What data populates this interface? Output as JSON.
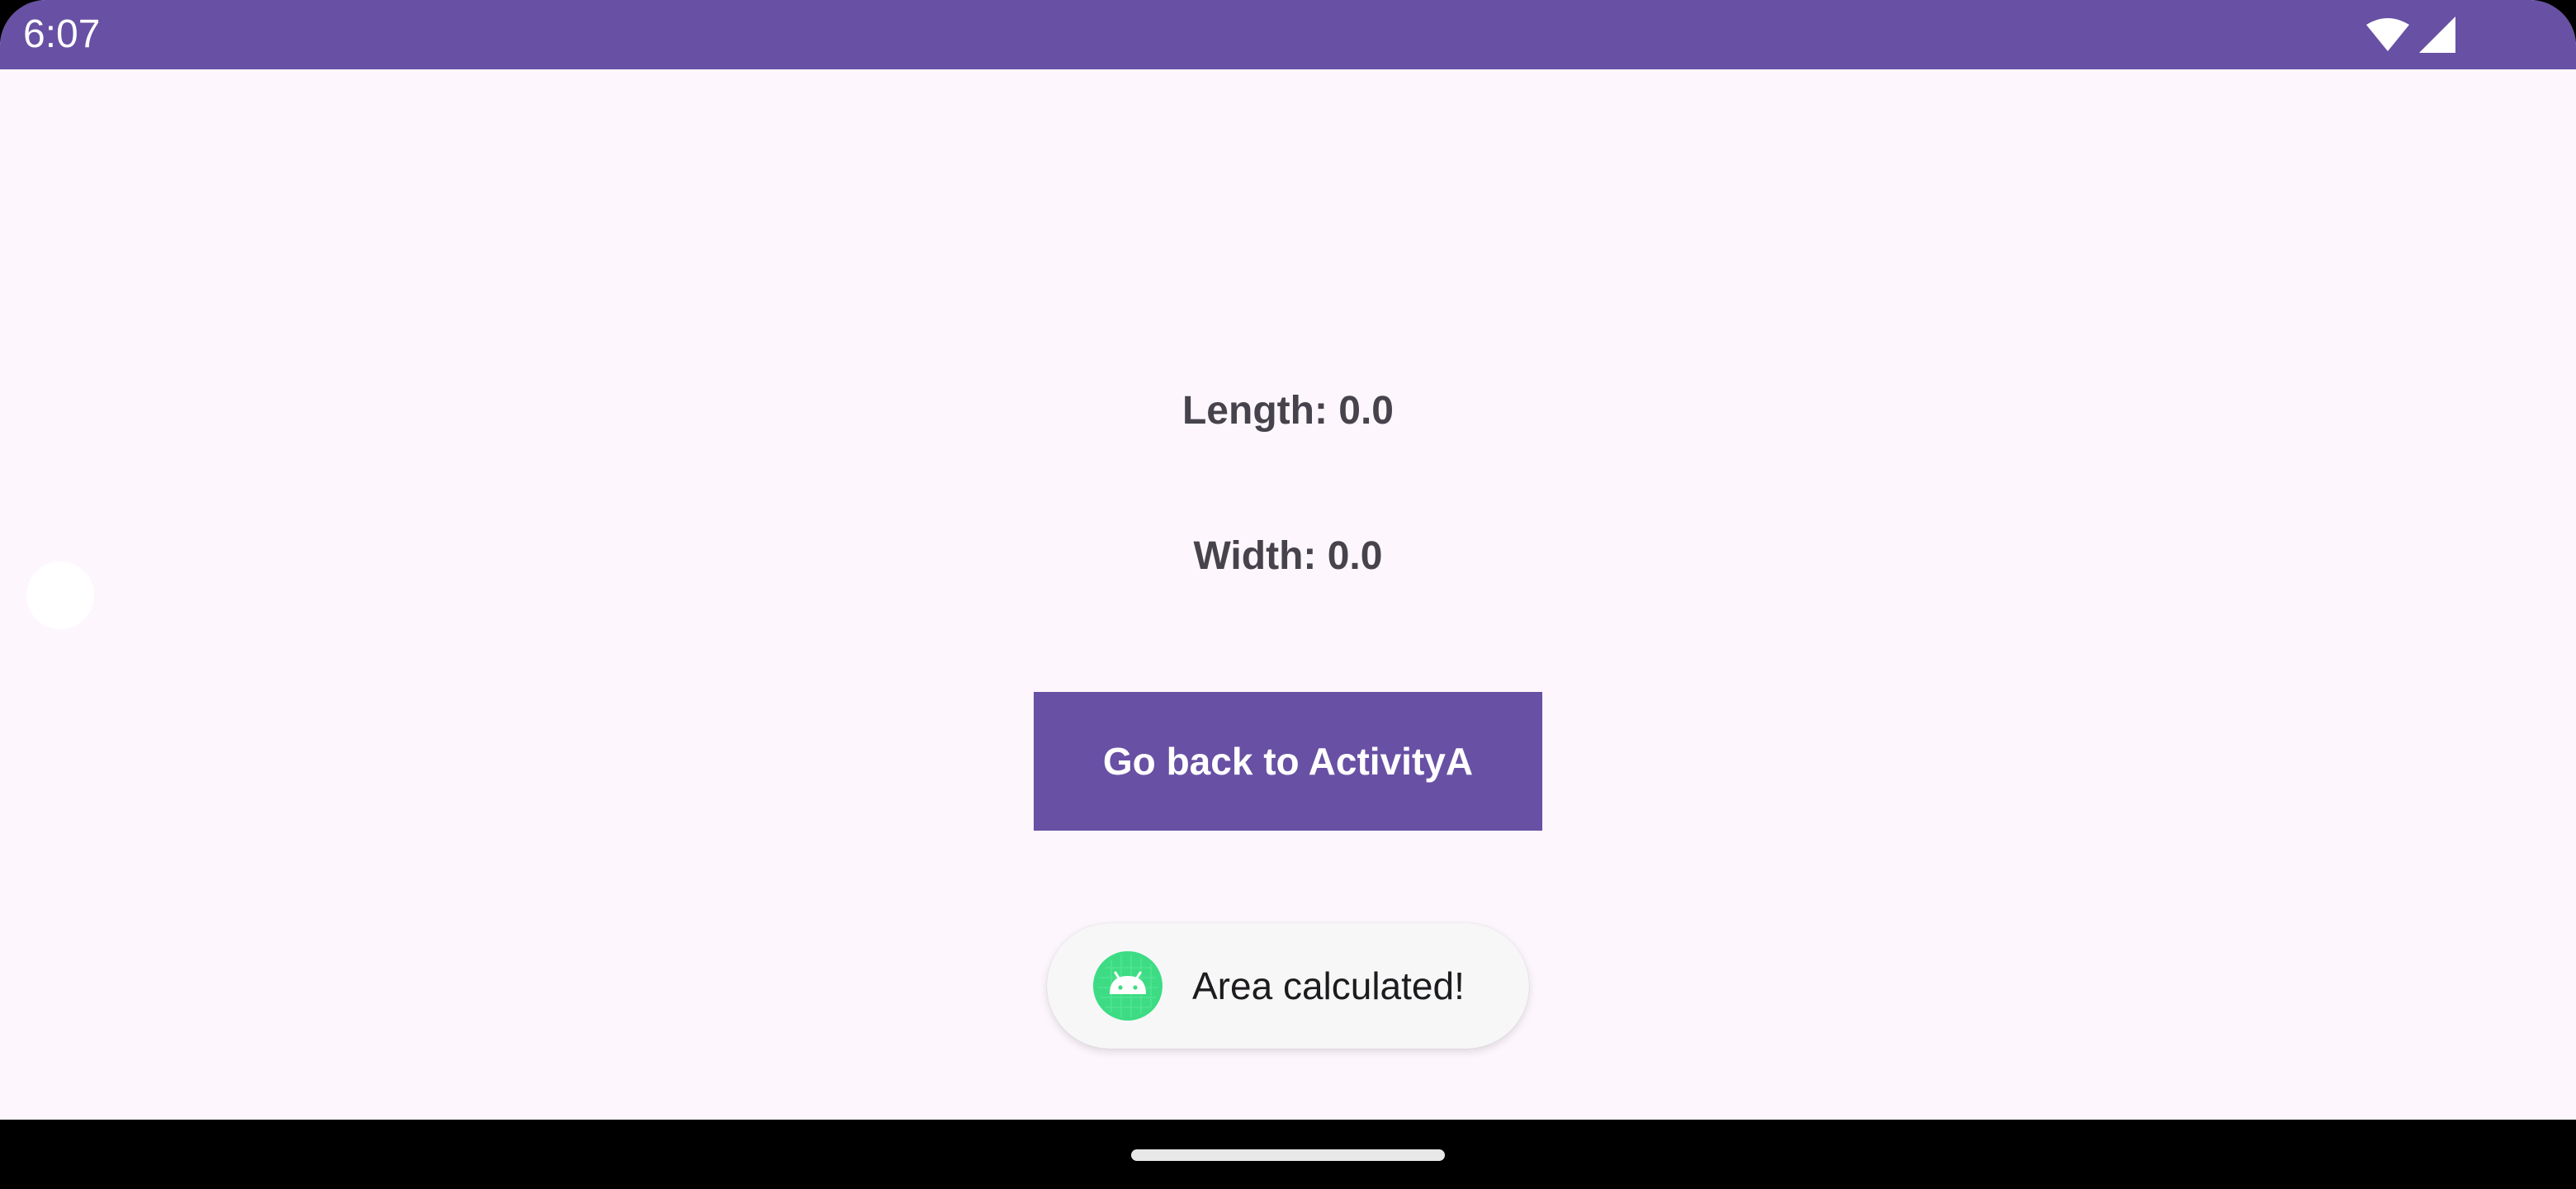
{
  "status_bar": {
    "time": "6:07",
    "icons": [
      "wifi-icon",
      "cell-signal-icon"
    ],
    "color": "#6850a4"
  },
  "main": {
    "length_text": "Length: 0.0",
    "width_text": "Width: 0.0",
    "back_button_label": "Go back to ActivityA",
    "accent_color": "#6850a4"
  },
  "toast": {
    "icon": "android-icon",
    "message": "Area calculated!"
  },
  "nav_bar": {
    "handle": "gesture-handle"
  }
}
